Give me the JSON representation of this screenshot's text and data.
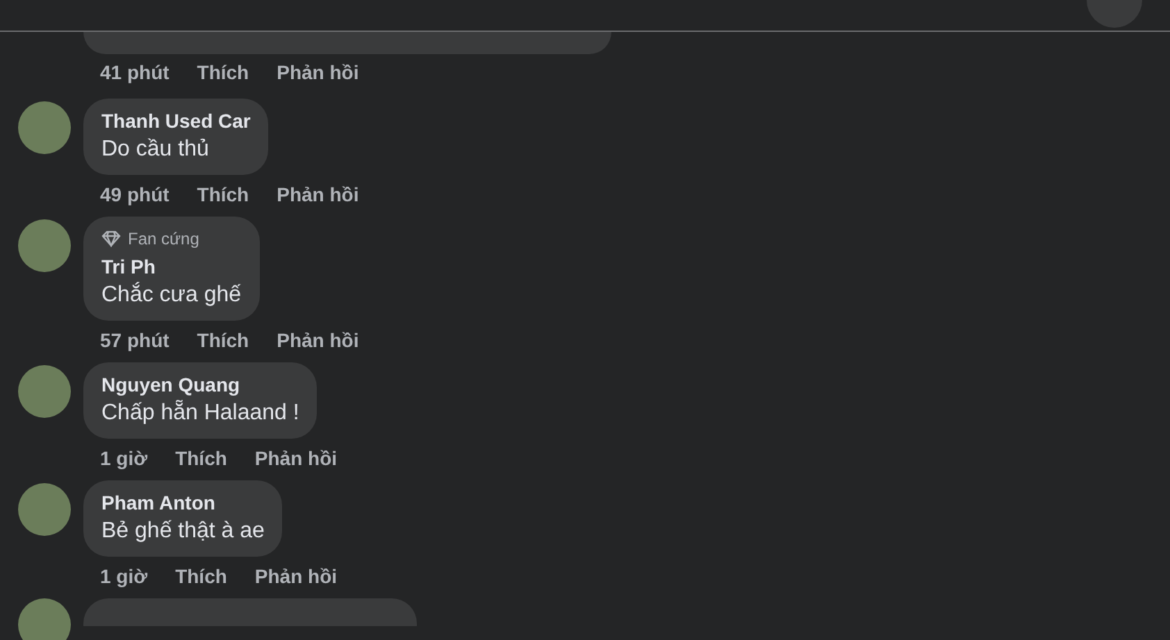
{
  "first_comment": {
    "time": "41 phút",
    "like": "Thích",
    "reply": "Phản hồi"
  },
  "comments": [
    {
      "name": "Thanh Used Car",
      "text": "Do cầu thủ",
      "time": "49 phút",
      "like": "Thích",
      "reply": "Phản hồi"
    },
    {
      "name": "Tri Ph",
      "badge": "Fan cứng",
      "text": "Chắc cưa ghế",
      "time": "57 phút",
      "like": "Thích",
      "reply": "Phản hồi"
    },
    {
      "name": "Nguyen Quang",
      "text": "Chấp hẵn Halaand !",
      "time": "1 giờ",
      "like": "Thích",
      "reply": "Phản hồi"
    },
    {
      "name": "Pham Anton",
      "text": "Bẻ ghế thật à ae",
      "time": "1 giờ",
      "like": "Thích",
      "reply": "Phản hồi"
    }
  ]
}
